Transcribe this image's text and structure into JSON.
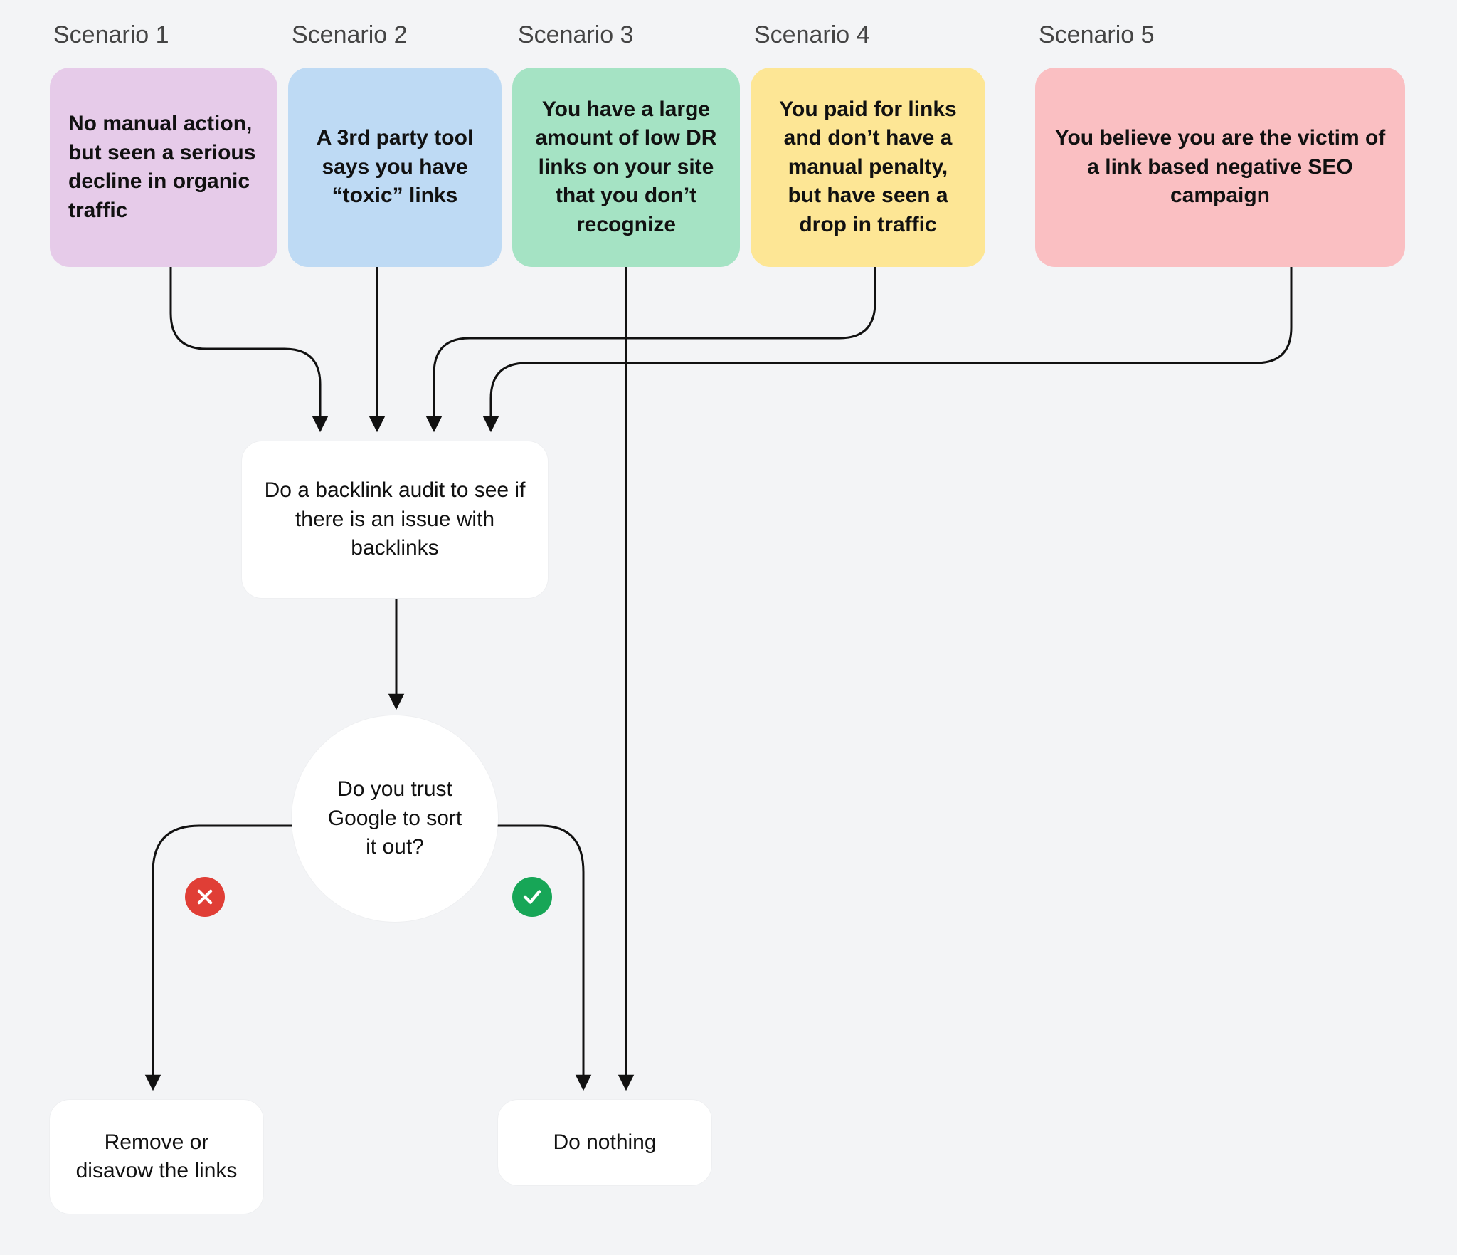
{
  "scenarios": [
    {
      "title": "Scenario 1",
      "text": "No manual action, but seen a serious decline in organic traffic",
      "color": "#e6cbe9"
    },
    {
      "title": "Scenario 2",
      "text": "A 3rd party tool says you have “toxic” links",
      "color": "#bedaf4"
    },
    {
      "title": "Scenario 3",
      "text": "You have a large amount of low DR links on your site that you don’t recognize",
      "color": "#a5e3c4"
    },
    {
      "title": "Scenario 4",
      "text": "You paid for links and don’t have a manual penalty, but have seen a drop in traffic",
      "color": "#fde695"
    },
    {
      "title": "Scenario 5",
      "text": "You believe you are the victim of a link based negative SEO campaign",
      "color": "#fabfc2"
    }
  ],
  "nodes": {
    "audit": "Do a backlink audit to see if there is an issue with backlinks",
    "trust": "Do you trust Google to sort it out?",
    "remove": "Remove or disavow the links",
    "nothing": "Do nothing"
  },
  "badges": {
    "no": {
      "icon": "cross",
      "color": "#e03e36"
    },
    "yes": {
      "icon": "check",
      "color": "#17a657"
    }
  }
}
